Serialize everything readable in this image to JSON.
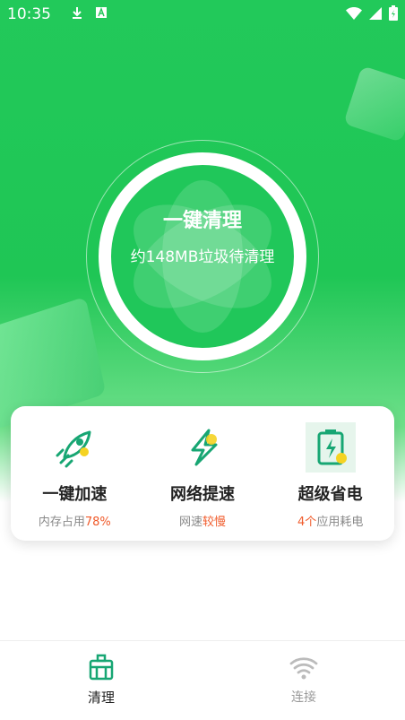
{
  "status_bar": {
    "time": "10:35",
    "left_icons": [
      "download-icon",
      "a-badge-icon"
    ],
    "right_icons": [
      "wifi-icon",
      "signal-icon",
      "battery-icon"
    ]
  },
  "hero": {
    "title": "一键清理",
    "subtitle": "约148MB垃圾待清理"
  },
  "features": [
    {
      "title": "一键加速",
      "desc_prefix": "内存占用",
      "desc_highlight": "78%",
      "desc_suffix": "",
      "icon": "rocket-icon"
    },
    {
      "title": "网络提速",
      "desc_prefix": "网速",
      "desc_highlight": "较慢",
      "desc_suffix": "",
      "icon": "lightning-icon"
    },
    {
      "title": "超级省电",
      "desc_prefix": "",
      "desc_highlight": "4个",
      "desc_suffix": "应用耗电",
      "icon": "battery-charge-icon"
    }
  ],
  "tabs": [
    {
      "label": "清理",
      "icon": "cleaner-icon",
      "active": true
    },
    {
      "label": "连接",
      "icon": "wifi-icon",
      "active": false
    }
  ],
  "colors": {
    "brand_green": "#20c75a",
    "highlight_orange": "#f05a2a",
    "icon_teal": "#17a673",
    "icon_yellow": "#f5d322"
  }
}
